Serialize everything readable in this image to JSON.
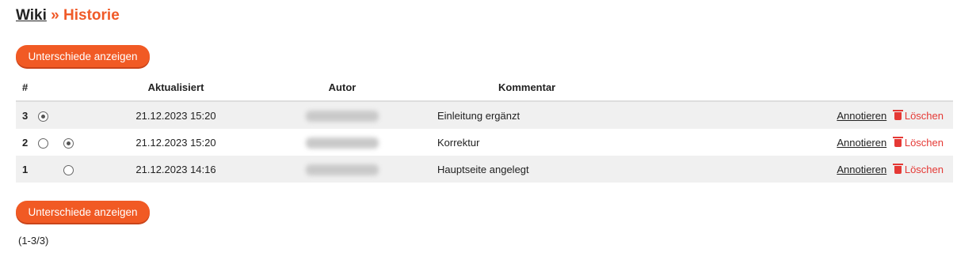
{
  "header": {
    "wiki": "Wiki",
    "separator": " » ",
    "page": "Historie"
  },
  "buttons": {
    "diff_label": "Unterschiede anzeigen"
  },
  "table": {
    "headers": {
      "num": "#",
      "updated": "Aktualisiert",
      "author": "Autor",
      "comment": "Kommentar"
    },
    "rows": [
      {
        "num": "3",
        "radio1": "checked",
        "radio2": "none",
        "date": "21.12.2023 15:20",
        "comment": "Einleitung ergänzt",
        "annotate": "Annotieren",
        "delete": "Löschen"
      },
      {
        "num": "2",
        "radio1": "unchecked",
        "radio2": "checked",
        "date": "21.12.2023 15:20",
        "comment": "Korrektur",
        "annotate": "Annotieren",
        "delete": "Löschen"
      },
      {
        "num": "1",
        "radio1": "none",
        "radio2": "unchecked",
        "date": "21.12.2023 14:16",
        "comment": "Hauptseite angelegt",
        "annotate": "Annotieren",
        "delete": "Löschen"
      }
    ]
  },
  "pagination": {
    "range": "(1-3/3)"
  },
  "colors": {
    "accent": "#f15a24",
    "delete": "#e53935"
  }
}
